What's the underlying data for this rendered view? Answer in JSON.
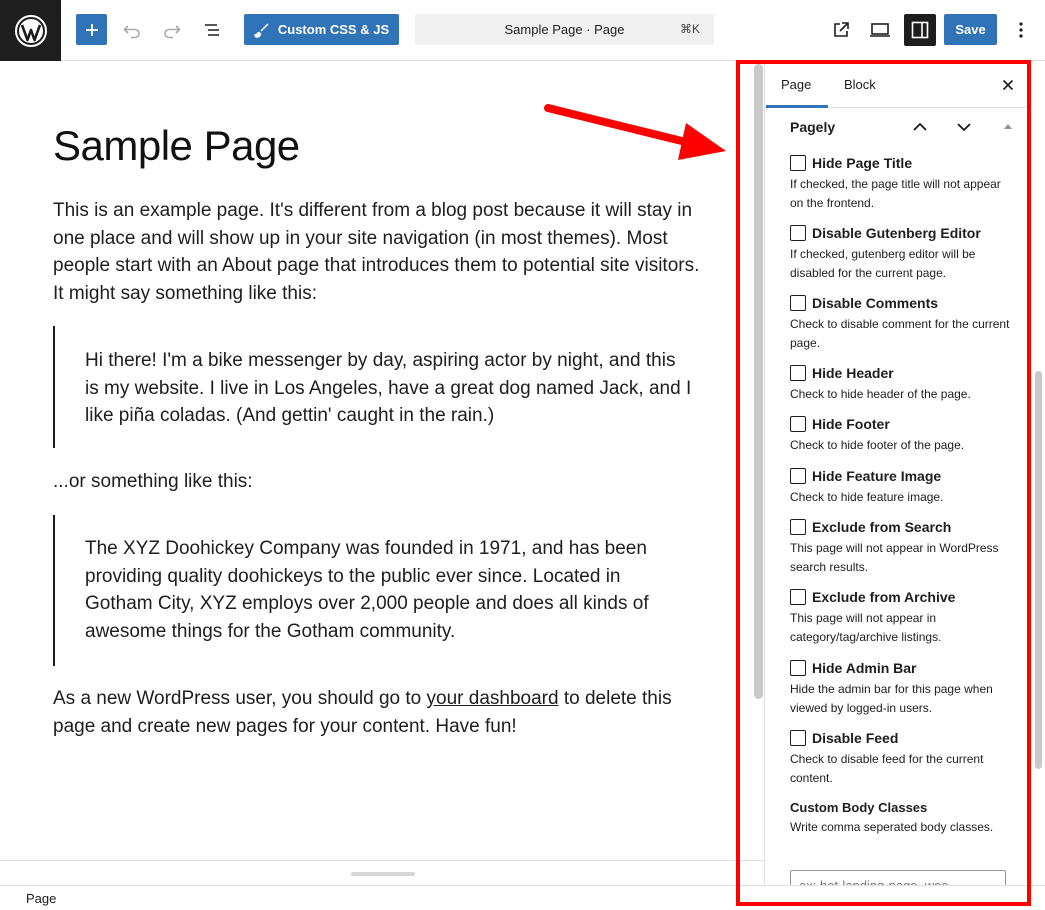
{
  "toolbar": {
    "add_label": "+",
    "css_button_label": "Custom CSS & JS",
    "command_text": "Sample Page · Page",
    "command_shortcut": "⌘K",
    "save_label": "Save"
  },
  "content": {
    "title": "Sample Page",
    "para1": "This is an example page. It's different from a blog post because it will stay in one place and will show up in your site navigation (in most themes). Most people start with an About page that introduces them to potential site visitors. It might say something like this:",
    "quote1": "Hi there! I'm a bike messenger by day, aspiring actor by night, and this is my website. I live in Los Angeles, have a great dog named Jack, and I like piña coladas. (And gettin' caught in the rain.)",
    "para2": "...or something like this:",
    "quote2": "The XYZ Doohickey Company was founded in 1971, and has been providing quality doohickeys to the public ever since. Located in Gotham City, XYZ employs over 2,000 people and does all kinds of awesome things for the Gotham community.",
    "para3_before": "As a new WordPress user, you should go to ",
    "para3_link": "your dashboard",
    "para3_after": " to delete this page and create new pages for your content. Have fun!"
  },
  "sidebar": {
    "tabs": [
      {
        "label": "Page"
      },
      {
        "label": "Block"
      }
    ],
    "panel_title": "Pagely",
    "options": [
      {
        "label": "Hide Page Title",
        "help": "If checked, the page title will not appear on the frontend."
      },
      {
        "label": "Disable Gutenberg Editor",
        "help": "If checked, gutenberg editor will be disabled for the current page."
      },
      {
        "label": "Disable Comments",
        "help": "Check to disable comment for the current page."
      },
      {
        "label": "Hide Header",
        "help": "Check to hide header of the page."
      },
      {
        "label": "Hide Footer",
        "help": "Check to hide footer of the page."
      },
      {
        "label": "Hide Feature Image",
        "help": "Check to hide feature image."
      },
      {
        "label": "Exclude from Search",
        "help": "This page will not appear in WordPress search results."
      },
      {
        "label": "Exclude from Archive",
        "help": "This page will not appear in category/tag/archive listings."
      },
      {
        "label": "Hide Admin Bar",
        "help": "Hide the admin bar for this page when viewed by logged-in users."
      },
      {
        "label": "Disable Feed",
        "help": "Check to disable feed for the current content."
      }
    ],
    "body_classes": {
      "label": "Custom Body Classes",
      "help": "Write comma seperated body classes.",
      "placeholder": "ex: hot-landing-page, woo-"
    }
  },
  "status": {
    "breadcrumb": "Page"
  },
  "colors": {
    "accent": "#3173b7",
    "annotation": "#ff0000"
  }
}
